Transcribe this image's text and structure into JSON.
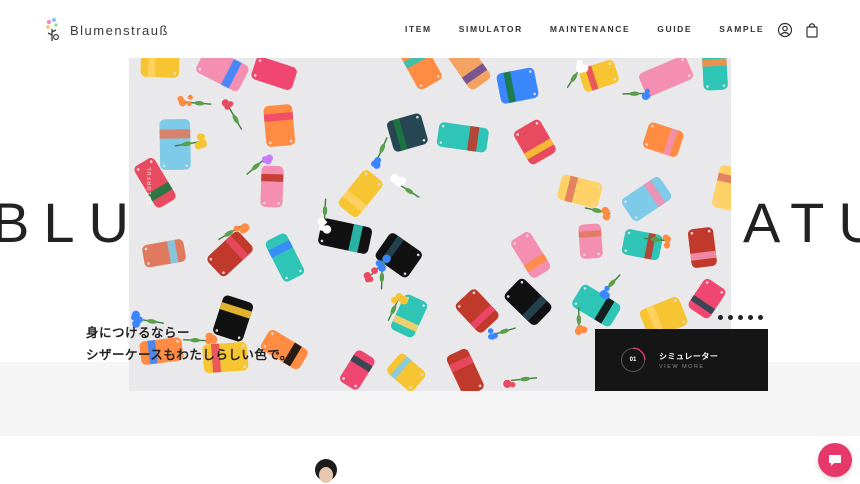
{
  "header": {
    "logo_text": "Blumenstrauß",
    "nav": [
      "ITEM",
      "SIMULATOR",
      "MAINTENANCE",
      "GUIDE",
      "SAMPLE"
    ],
    "icons": [
      "account-icon",
      "cart-icon"
    ]
  },
  "hero": {
    "big_word": "BLUMENSTRAUSS BLUMENSTRAUSS BLUMENSTRAUSS",
    "visible_big_word_left": "BLU",
    "visible_big_word_right": "ATU",
    "vertical_label": "COLORFUL",
    "catch_line1": "身につけるならー",
    "catch_line2": "シザーケースもわたしらしい色で。",
    "slide_count": 5
  },
  "card": {
    "number": "01",
    "title": "シミュレーター",
    "subtitle": "VIEW MORE"
  },
  "colors": {
    "accent_chat": "#e6396a",
    "card_bg": "#151515",
    "band_bg": "#f5f5f5"
  }
}
